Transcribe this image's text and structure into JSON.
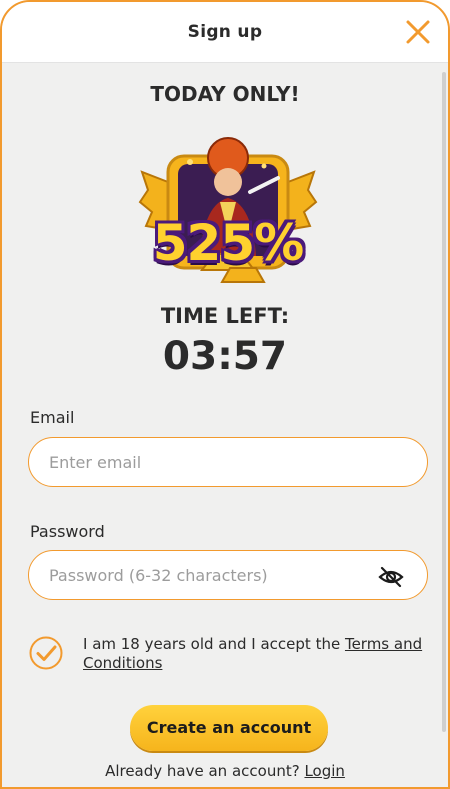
{
  "header": {
    "title": "Sign up",
    "close_icon": "close-icon"
  },
  "promo": {
    "heading": "TODAY ONLY!",
    "badge_value": "525%",
    "timer_label": "TIME LEFT:",
    "timer_value": "03:57"
  },
  "form": {
    "email_label": "Email",
    "email_placeholder": "Enter email",
    "email_value": "",
    "password_label": "Password",
    "password_placeholder": "Password (6-32 characters)",
    "password_value": "",
    "password_visibility_icon": "eye-off-icon",
    "terms_checked": true,
    "terms_text": "I am 18 years old and I accept the ",
    "terms_link": "Terms and Conditions",
    "submit_label": "Create an account",
    "login_prompt": "Already have an account? ",
    "login_link": "Login"
  },
  "colors": {
    "accent": "#f29a2e",
    "button": "#f6b41c",
    "background": "#f0f0ef"
  }
}
